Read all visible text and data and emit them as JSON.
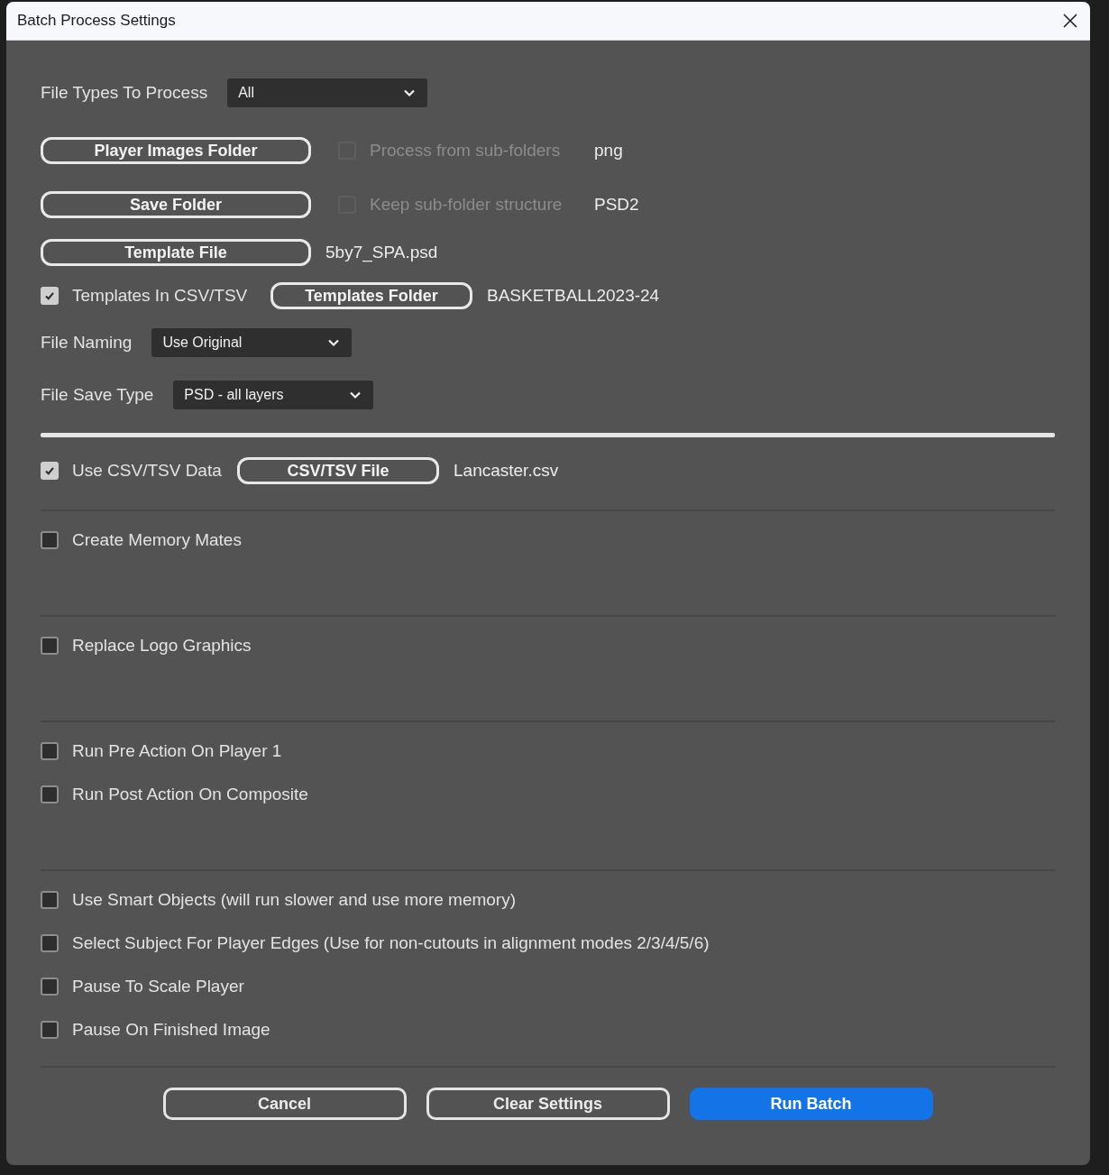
{
  "window": {
    "title": "Batch Process Settings"
  },
  "file_types": {
    "label": "File Types To Process",
    "value": "All"
  },
  "folders": [
    {
      "button": "Player Images Folder",
      "option": {
        "label": "Process from sub-folders",
        "checked": false,
        "disabled": true
      },
      "value": "png"
    },
    {
      "button": "Save Folder",
      "option": {
        "label": "Keep sub-folder structure",
        "checked": false,
        "disabled": true
      },
      "value": "PSD2"
    },
    {
      "button": "Template File",
      "value": "5by7_SPA.psd"
    }
  ],
  "templates_csv": {
    "label": "Templates In CSV/TSV",
    "checked": true,
    "button": "Templates Folder",
    "value": "BASKETBALL2023-24"
  },
  "file_naming": {
    "label": "File Naming",
    "value": "Use Original"
  },
  "file_save_type": {
    "label": "File Save Type",
    "value": "PSD - all layers"
  },
  "csv_data": {
    "label": "Use CSV/TSV Data",
    "checked": true,
    "button": "CSV/TSV File",
    "value": "Lancaster.csv"
  },
  "sections": [
    {
      "options": [
        {
          "label": "Create Memory Mates",
          "checked": false
        }
      ]
    },
    {
      "options": [
        {
          "label": "Replace Logo Graphics",
          "checked": false
        }
      ]
    },
    {
      "options": [
        {
          "label": "Run Pre Action On Player 1",
          "checked": false
        },
        {
          "label": "Run Post Action On Composite",
          "checked": false
        }
      ]
    },
    {
      "options": [
        {
          "label": "Use Smart Objects (will run slower and use more memory)",
          "checked": false
        },
        {
          "label": "Select Subject For Player Edges (Use for non-cutouts in alignment modes 2/3/4/5/6)",
          "checked": false
        },
        {
          "label": "Pause To Scale Player",
          "checked": false
        },
        {
          "label": "Pause On Finished Image",
          "checked": false
        }
      ]
    }
  ],
  "buttons": [
    {
      "label": "Cancel",
      "kind": "outline"
    },
    {
      "label": "Clear Settings",
      "kind": "outline"
    },
    {
      "label": "Run Batch",
      "kind": "primary"
    }
  ]
}
